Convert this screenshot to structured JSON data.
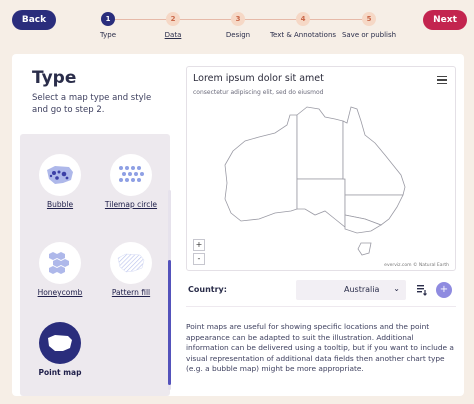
{
  "nav": {
    "back_label": "Back",
    "next_label": "Next",
    "steps": [
      {
        "num": "1",
        "label": "Type",
        "state": "active"
      },
      {
        "num": "2",
        "label": "Data",
        "state": "link"
      },
      {
        "num": "3",
        "label": "Design",
        "state": "upcoming"
      },
      {
        "num": "4",
        "label": "Text & Annotations",
        "state": "upcoming"
      },
      {
        "num": "5",
        "label": "Save or publish",
        "state": "upcoming"
      }
    ]
  },
  "type_panel": {
    "title": "Type",
    "description": "Select a map type and style and go to step 2.",
    "options": [
      {
        "label": "Bubble",
        "icon": "bubble-map-icon",
        "selected": false
      },
      {
        "label": "Tilemap circle",
        "icon": "tilemap-circle-icon",
        "selected": false
      },
      {
        "label": "Honeycomb",
        "icon": "honeycomb-icon",
        "selected": false
      },
      {
        "label": "Pattern fill",
        "icon": "pattern-fill-icon",
        "selected": false
      },
      {
        "label": "Point map",
        "icon": "point-map-icon",
        "selected": true
      }
    ]
  },
  "map": {
    "title": "Lorem ipsum dolor sit amet",
    "subtitle": "consectetur adipiscing elit, sed do eiusmod",
    "zoom_in": "+",
    "zoom_out": "-",
    "attribution": "everviz.com © Natural Earth"
  },
  "country": {
    "label": "Country:",
    "value": "Australia"
  },
  "description": "Point maps are useful for showing specific locations and the point appearance can be adapted to suit the illustration. Additional information can be delivered using a tooltip, but if you want to include a visual representation of additional data fields then another chart type (e.g. a bubble map) might be more appropriate.",
  "colors": {
    "primary": "#2a2d7c",
    "accent": "#c3244f",
    "background": "#f6eee6",
    "scroll": "#5452bb"
  }
}
